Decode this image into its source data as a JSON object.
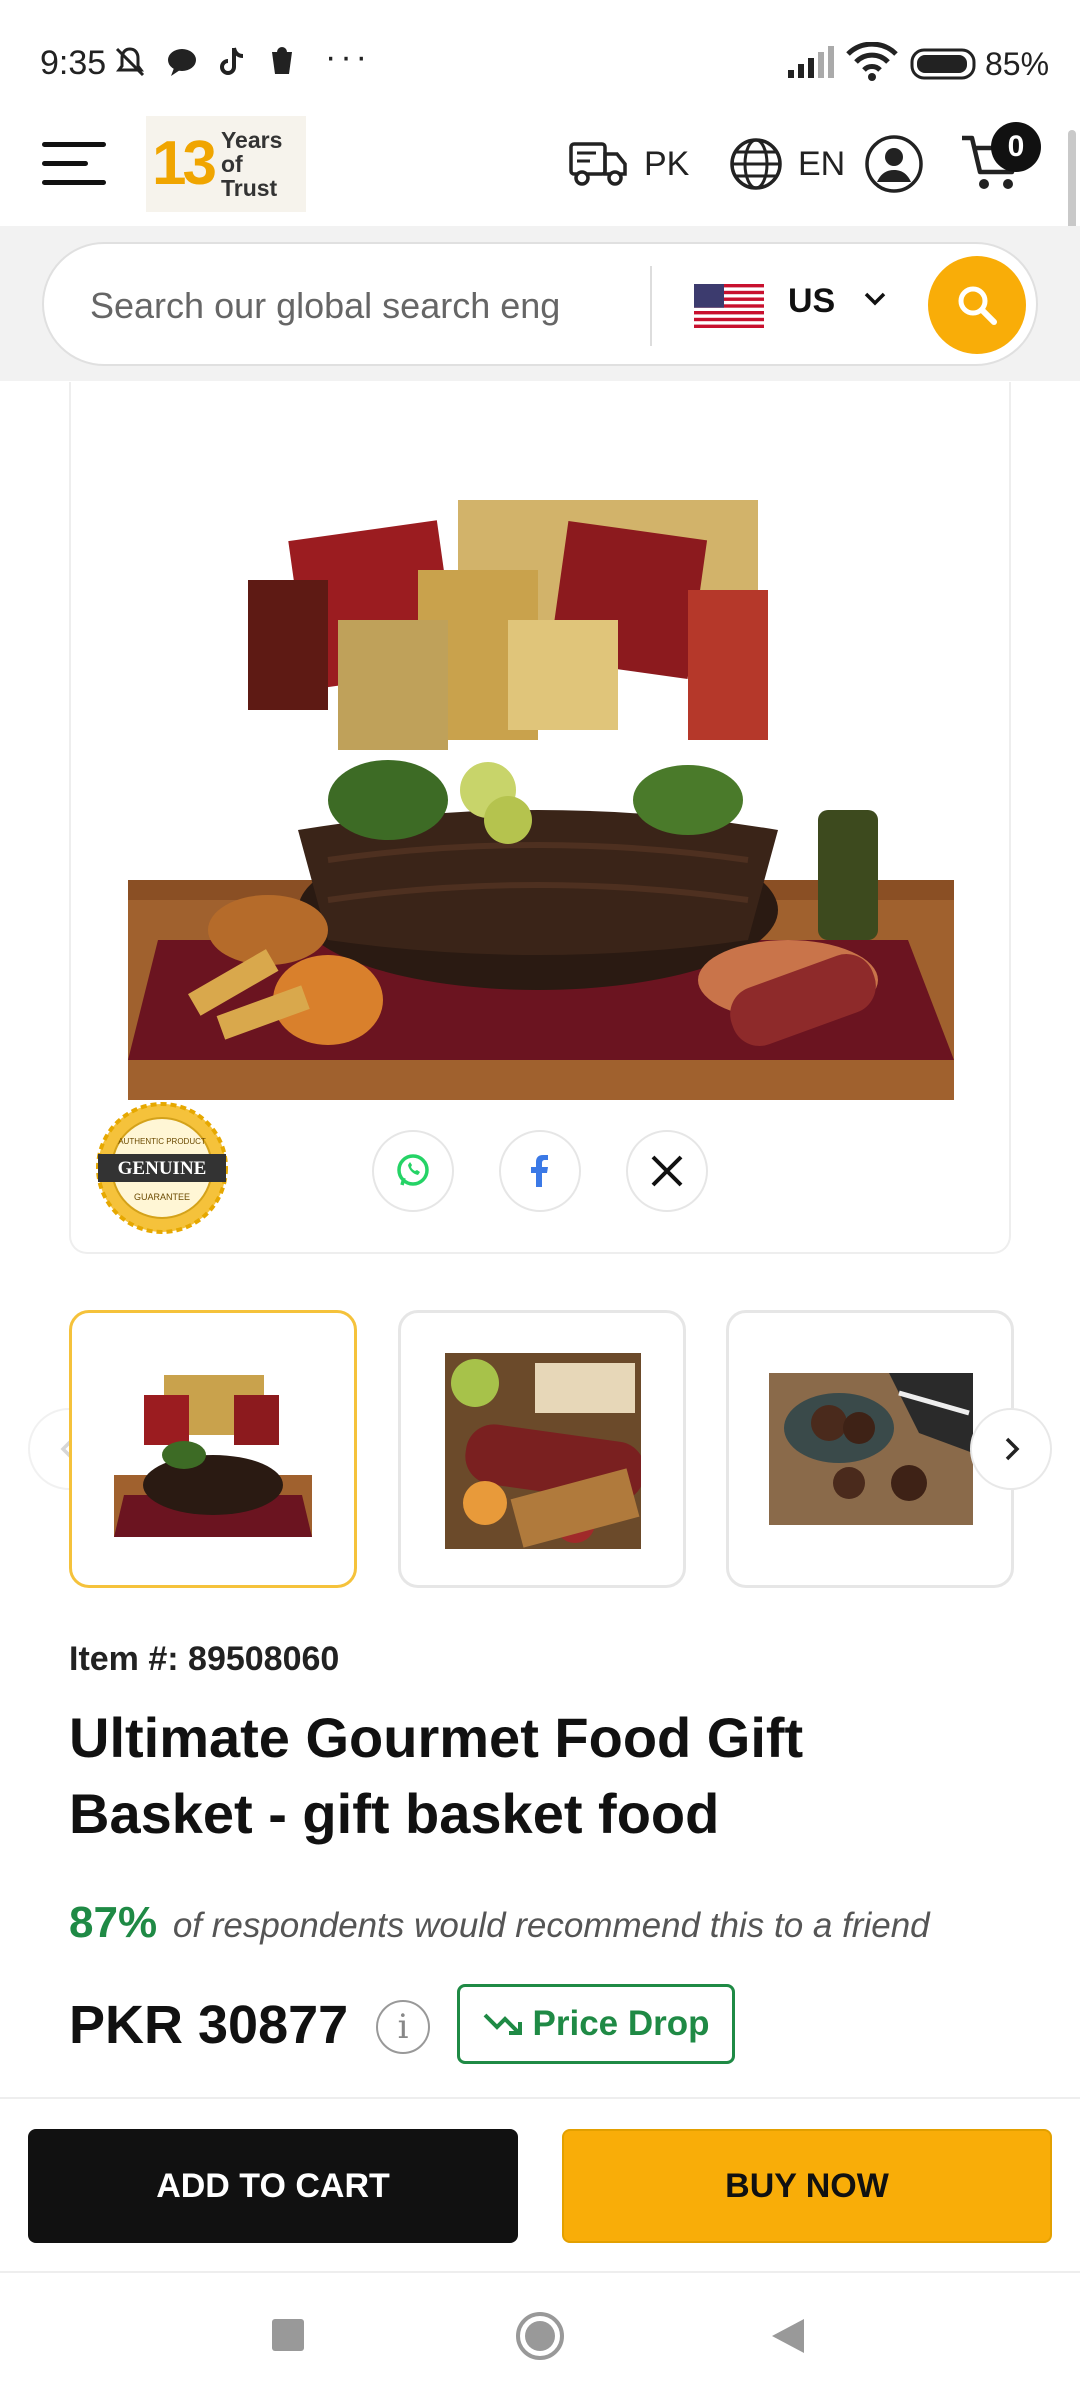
{
  "status_bar": {
    "time": "9:35",
    "battery": "85%",
    "more": "···"
  },
  "header": {
    "logo_number": "13",
    "logo_text_1": "Years of",
    "logo_text_2": "Trust",
    "shipping_country": "PK",
    "language": "EN",
    "cart_count": "0"
  },
  "search": {
    "placeholder": "Search our global search eng",
    "country": "US"
  },
  "product": {
    "item_number": "Item #: 89508060",
    "title": "Ultimate Gourmet Food Gift Basket - gift basket food",
    "recommend_pct": "87%",
    "recommend_text": "of respondents would recommend this to a friend",
    "price": "PKR 30877",
    "price_drop_label": "Price Drop"
  },
  "badge": {
    "genuine": "GENUINE",
    "authentic": "AUTHENTIC PRODUCT",
    "guarantee": "GUARANTEE"
  },
  "actions": {
    "add_to_cart": "ADD TO CART",
    "buy_now": "BUY NOW"
  },
  "colors": {
    "accent": "#f9ad08",
    "green": "#1f8a45",
    "dark": "#111111"
  }
}
